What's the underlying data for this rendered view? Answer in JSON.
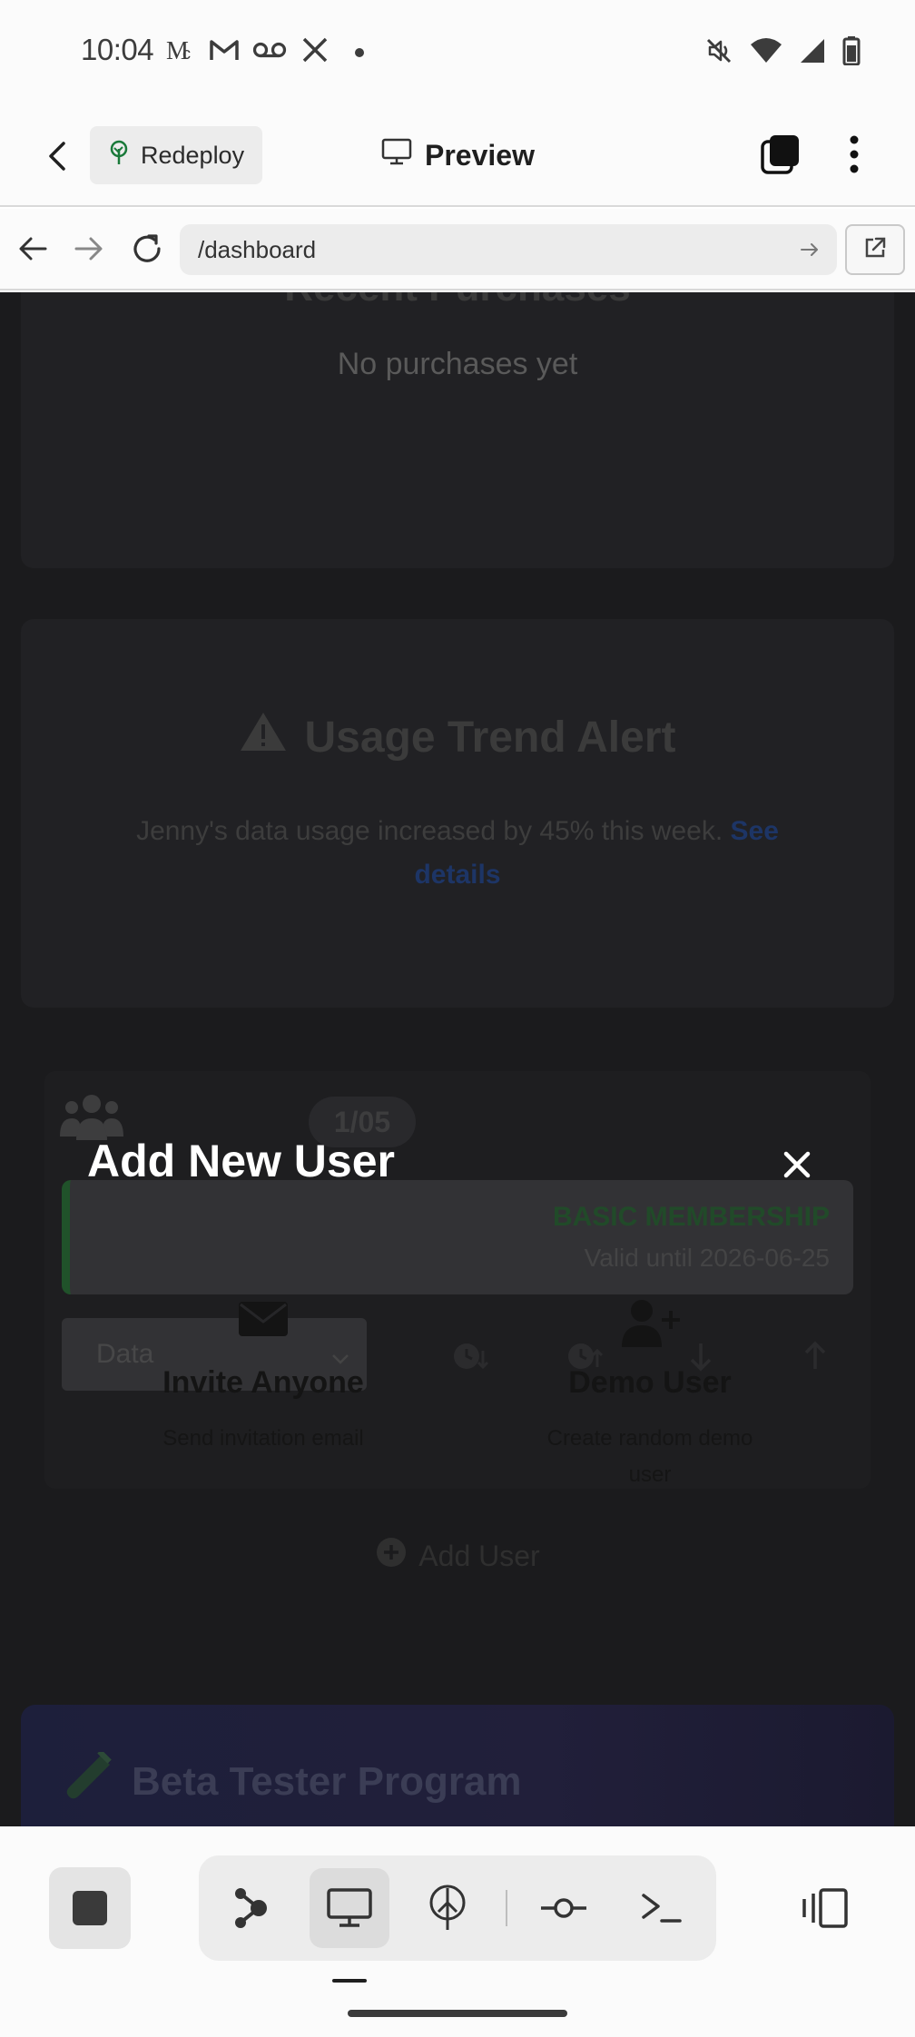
{
  "status_bar": {
    "time": "10:04",
    "notif_icons": [
      "messages-icon",
      "gmail-icon",
      "voicemail-icon",
      "x-icon",
      "dot-icon"
    ],
    "status_icons": [
      "mute-icon",
      "wifi-icon",
      "signal-icon",
      "battery-icon"
    ]
  },
  "app_bar": {
    "redeploy_label": "Redeploy",
    "preview_label": "Preview"
  },
  "browser": {
    "url": "/dashboard"
  },
  "page": {
    "purchases": {
      "title": "Recent Purchases",
      "empty_text": "No purchases yet"
    },
    "alert": {
      "title": "Usage Trend Alert",
      "message": "Jenny's data usage increased by 45% this week.",
      "link": "See details"
    },
    "members": {
      "count_badge": "1/05"
    },
    "membership": {
      "title": "BASIC MEMBERSHIP",
      "valid": "Valid until 2026-06-25"
    },
    "filter": {
      "selected": "Data"
    },
    "add_user_label": "Add User",
    "beta": {
      "title": "Beta Tester Program"
    }
  },
  "modal": {
    "title": "Add New User",
    "options": [
      {
        "name": "Invite Anyone",
        "desc": "Send invitation email"
      },
      {
        "name": "Demo User",
        "desc": "Create random demo user"
      }
    ]
  },
  "colors": {
    "overlay": "#1b1b1d",
    "membership_accent": "#1e6b2b",
    "link": "#1d3566"
  }
}
